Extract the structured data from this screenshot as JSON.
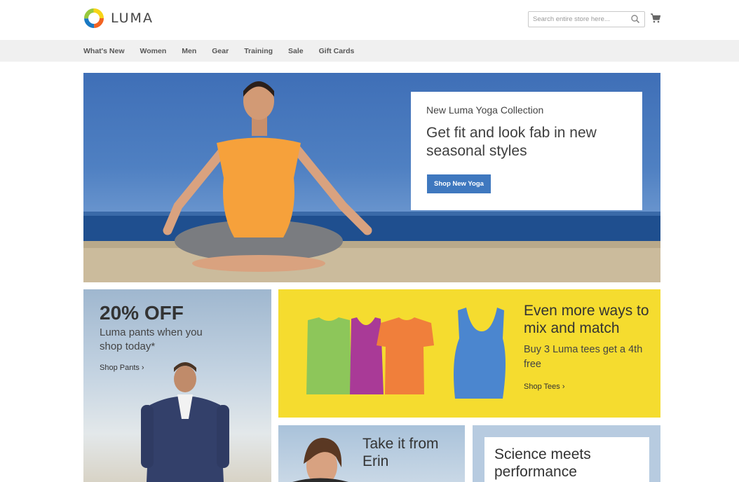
{
  "brand": {
    "name": "LUMA",
    "colors": [
      "#f26322",
      "#1979c3",
      "#97c93d",
      "#f7d417"
    ]
  },
  "header": {
    "search_placeholder": "Search entire store here...",
    "search_icon": "search-icon",
    "cart_icon": "cart-icon"
  },
  "nav": {
    "items": [
      "What's New",
      "Women",
      "Men",
      "Gear",
      "Training",
      "Sale",
      "Gift Cards"
    ]
  },
  "hero": {
    "kicker": "New Luma Yoga Collection",
    "title": "Get fit and look fab in new seasonal styles",
    "button": "Shop New Yoga"
  },
  "promos": {
    "pants": {
      "title": "20% OFF",
      "subtitle": "Luma pants when you shop today*",
      "link": "Shop Pants ›"
    },
    "tees": {
      "title": "Even more ways to mix and match",
      "subtitle": "Buy 3 Luma tees get a 4th free",
      "link": "Shop Tees ›",
      "shirt_colors": [
        "#8dc65a",
        "#a93a97",
        "#f07f3b",
        "#4b86cf"
      ]
    },
    "erin": {
      "title": "Take it from Erin"
    },
    "science": {
      "title": "Science meets performance"
    }
  },
  "accent_color": "#3f78bf"
}
